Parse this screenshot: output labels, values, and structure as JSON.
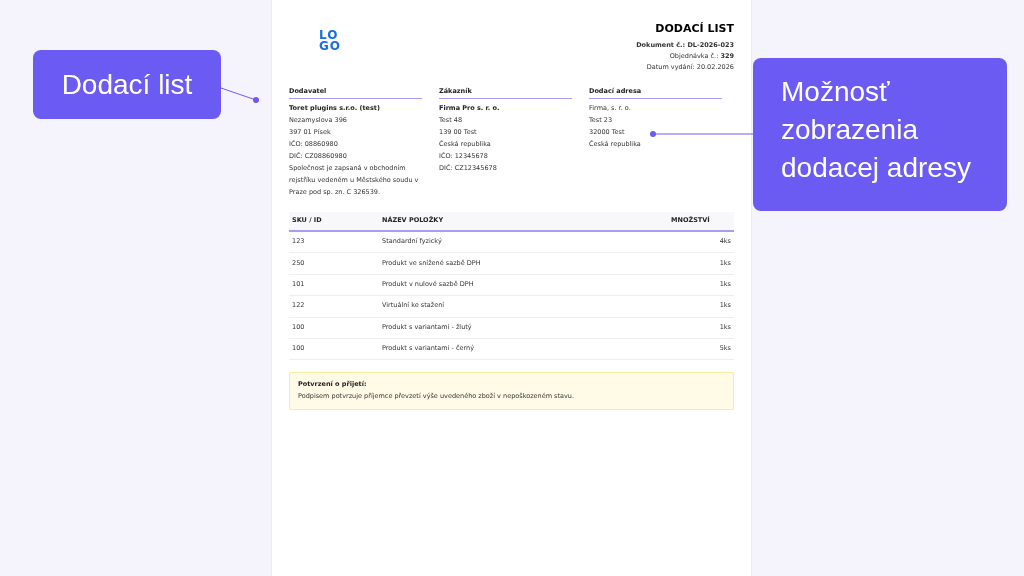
{
  "document": {
    "logo": [
      "LO",
      "GO"
    ],
    "title": "DODACÍ LIST",
    "meta": [
      "**Dokument č.: DL-2026-023**",
      "Objednávka č.: **329**",
      "Datum vydání: 20.02.2026"
    ],
    "parties": [
      {
        "heading": "Dodavatel",
        "name": "Toret plugins s.r.o. (test)",
        "lines": [
          "Nezamyslova 396",
          "397 01 Písek",
          "IČO: 08860980",
          "DIČ: CZ08860980",
          "Společnost je zapsaná v obchodním rejstříku vedeném u Městského soudu v Praze pod sp. zn. C 326539."
        ]
      },
      {
        "heading": "Zákazník",
        "name": "Firma Pro s. r. o.",
        "lines": [
          "Test 48",
          "139 00 Test",
          "Česká republika",
          "IČO: 12345678",
          "DIČ: CZ12345678"
        ]
      },
      {
        "heading": "Dodací adresa",
        "lines": [
          "Firma, s. r. o.",
          "Test 23",
          "32000 Test",
          "Česká republika"
        ]
      }
    ],
    "table": {
      "columns": [
        "SKU / ID",
        "NÁZEV POLOŽKY",
        "MNOŽSTVÍ"
      ],
      "rows": [
        [
          "123",
          "Standardní fyzický",
          "4ks"
        ],
        [
          "250",
          "Produkt ve snížené sazbě DPH",
          "1ks"
        ],
        [
          "101",
          "Produkt v nulové sazbě DPH",
          "1ks"
        ],
        [
          "122",
          "Virtuální ke stažení",
          "1ks"
        ],
        [
          "100",
          "Produkt s variantami - žlutý",
          "1ks"
        ],
        [
          "100",
          "Produkt s variantami - černý",
          "5ks"
        ]
      ]
    },
    "notice": {
      "title": "Potvrzení o přijetí:",
      "text": "Podpisem potvrzuje příjemce převzetí výše uvedeného zboží v nepoškozeném stavu."
    }
  },
  "callouts": [
    {
      "text": "Dodací list"
    },
    {
      "text": "Možnosť zobrazenia dodacej adresy"
    }
  ]
}
